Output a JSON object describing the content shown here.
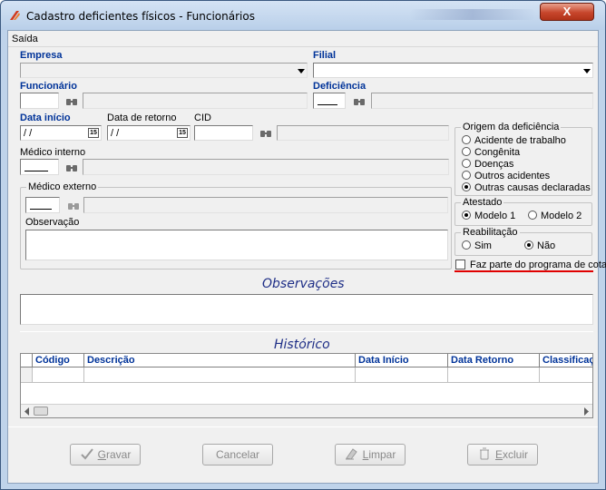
{
  "window": {
    "title": "Cadastro deficientes físicos - Funcionários",
    "close_label": "X"
  },
  "menu": {
    "items": [
      "Saída"
    ]
  },
  "form": {
    "empresa_label": "Empresa",
    "filial_label": "Filial",
    "funcionario_label": "Funcionário",
    "deficiencia_label": "Deficiência",
    "data_inicio_label": "Data início",
    "data_inicio_value": "/ /",
    "data_retorno_label": "Data de retorno",
    "data_retorno_value": "/ /",
    "cid_label": "CID",
    "medico_interno_label": "Médico interno",
    "medico_externo_label": "Médico externo",
    "observacao_label": "Observação",
    "calendar_icon_text": "15"
  },
  "origem": {
    "title": "Origem da deficiência",
    "options": [
      "Acidente de trabalho",
      "Congênita",
      "Doenças",
      "Outros acidentes",
      "Outras causas declaradas"
    ],
    "selected_index": 4
  },
  "atestado": {
    "title": "Atestado",
    "options": [
      "Modelo 1",
      "Modelo 2"
    ],
    "selected_index": 0
  },
  "reabilitacao": {
    "title": "Reabilitação",
    "options": [
      "Sim",
      "Não"
    ],
    "selected_index": 1
  },
  "cotas_checkbox": {
    "label": "Faz parte do programa de cotas",
    "checked": false
  },
  "observacoes_title": "Observações",
  "historico": {
    "title": "Histórico",
    "columns": [
      "Código",
      "Descrição",
      "Data Início",
      "Data Retorno",
      "Classificaç"
    ]
  },
  "buttons": {
    "gravar": {
      "first": "G",
      "rest": "ravar"
    },
    "cancelar": "Cancelar",
    "limpar": {
      "first": "L",
      "rest": "impar"
    },
    "excluir": {
      "first": "E",
      "rest": "xcluir"
    }
  },
  "colors": {
    "accent_label": "#003399",
    "section_title": "#1f2f87",
    "highlight": "#e00000"
  }
}
